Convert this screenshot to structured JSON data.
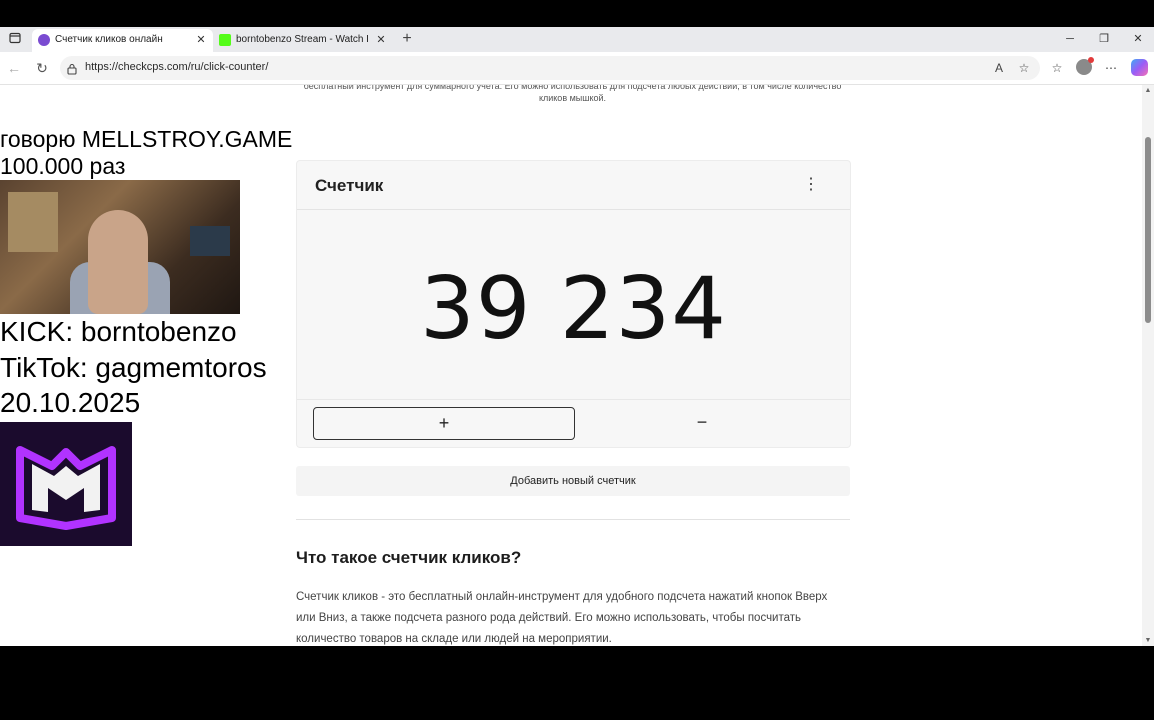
{
  "browser": {
    "tabs": [
      {
        "title": "Счетчик кликов онлайн",
        "active": true
      },
      {
        "title": "borntobenzo Stream - Watch Live",
        "active": false
      }
    ],
    "url": "https://checkcps.com/ru/click-counter/"
  },
  "page": {
    "intro_text": "бесплатный инструмент для суммарного учета. Его можно использовать для подсчета любых действий, в том числе количество кликов мышкой.",
    "counter_card": {
      "title": "Счетчик",
      "value": "39 234",
      "plus_label": "+",
      "minus_label": "−"
    },
    "add_counter_label": "Добавить новый счетчик",
    "section_heading": "Что такое счетчик кликов?",
    "section_paragraph": "Счетчик кликов - это бесплатный онлайн-инструмент для удобного подсчета нажатий кнопок Вверх или Вниз, а также подсчета разного рода действий. Его можно использовать, чтобы посчитать количество товаров на складе или людей на мероприятии."
  },
  "overlay": {
    "line1": "говорю MELLSTROY.GAME",
    "line2": "100.000 раз",
    "line3": "KICK: borntobenzo",
    "line4": "TikTok: gagmemtoros",
    "line5": "20.10.2025"
  },
  "colors": {
    "kick_green": "#53fc18",
    "logo_purple": "#b133ff"
  }
}
